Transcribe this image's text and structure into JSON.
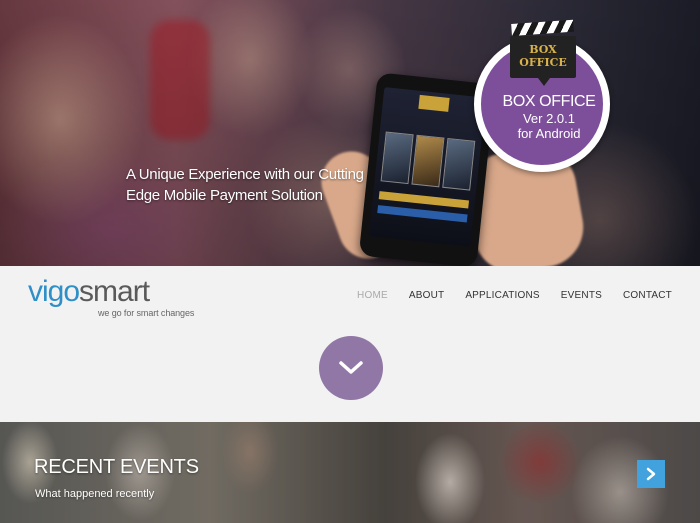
{
  "hero": {
    "tagline": "A Unique Experience with our Cutting Edge Mobile Payment Solution",
    "badge": {
      "clapper_line1": "BOX",
      "clapper_line2": "OFFICE",
      "title": "BOX OFFICE",
      "version": "Ver 2.0.1",
      "platform": "for Android",
      "color": "#7d4f9a"
    }
  },
  "header": {
    "logo": {
      "part1": "vigo",
      "part2": "smart",
      "tagline": "we go for smart changes"
    },
    "nav": [
      {
        "label": "HOME",
        "active": true
      },
      {
        "label": "ABOUT"
      },
      {
        "label": "APPLICATIONS"
      },
      {
        "label": "EVENTS"
      },
      {
        "label": "CONTACT"
      }
    ]
  },
  "scroll_button": {
    "icon": "chevron-down-icon",
    "color": "#9177a5"
  },
  "events": {
    "title": "RECENT EVENTS",
    "subtitle": "What happened recently",
    "next_icon": "chevron-right-icon",
    "accent": "#41a2dd"
  }
}
